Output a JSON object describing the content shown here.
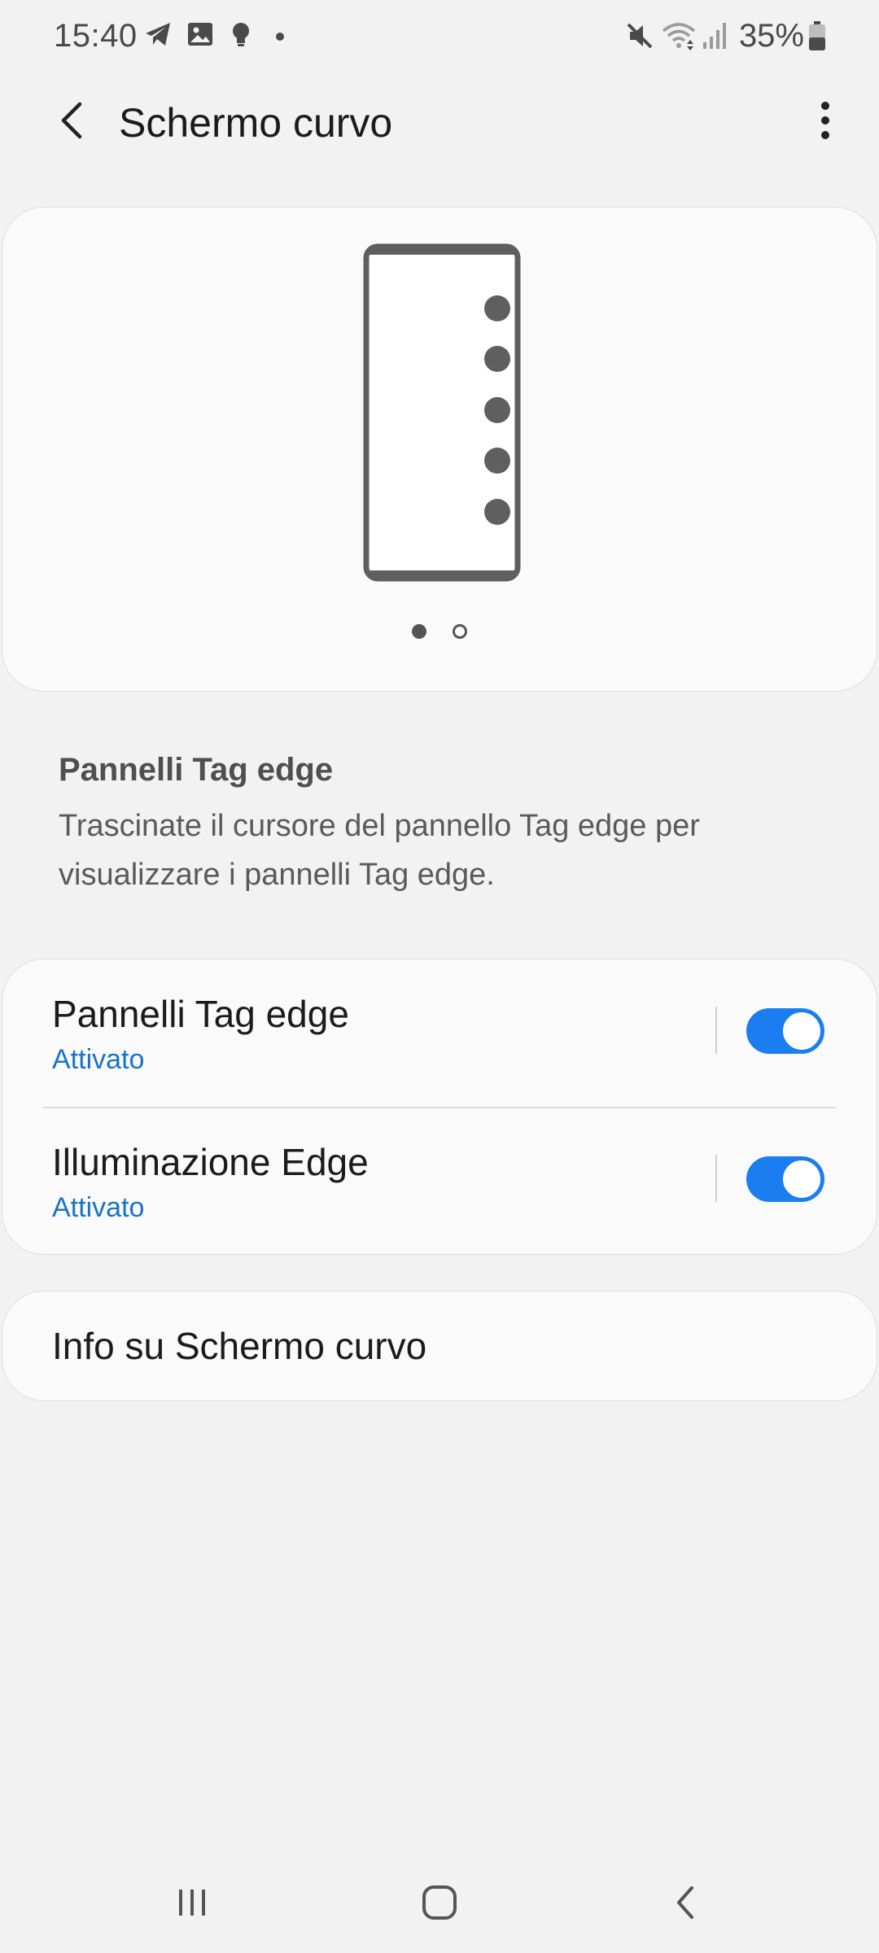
{
  "status_bar": {
    "time": "15:40",
    "left_icons": [
      "telegram-icon",
      "gallery-icon",
      "bulb-icon",
      "notification-dot-icon"
    ],
    "right_icons": [
      "mute-icon",
      "wifi-icon",
      "signal-icon",
      "battery-icon"
    ],
    "battery_percent": "35%"
  },
  "app_bar": {
    "title": "Schermo curvo",
    "back_icon": "chevron-left-icon",
    "menu_icon": "more-vertical-icon"
  },
  "illustration": {
    "carousel_pages": 2,
    "current_page": 1,
    "dot_color": "#5f5f5f"
  },
  "description": {
    "title": "Pannelli Tag edge",
    "text": "Trascinate il cursore del pannello Tag edge per visualizzare i pannelli Tag edge."
  },
  "settings": [
    {
      "label": "Pannelli Tag edge",
      "status": "Attivato",
      "enabled": true
    },
    {
      "label": "Illuminazione Edge",
      "status": "Attivato",
      "enabled": true
    }
  ],
  "info": {
    "label": "Info su Schermo curvo"
  },
  "colors": {
    "accent": "#1a7ef1",
    "status_text": "#1a73c9",
    "background": "#f2f2f2",
    "card": "#fafafa"
  },
  "nav_bar": {
    "icons": [
      "recents-icon",
      "home-icon",
      "back-icon"
    ]
  }
}
